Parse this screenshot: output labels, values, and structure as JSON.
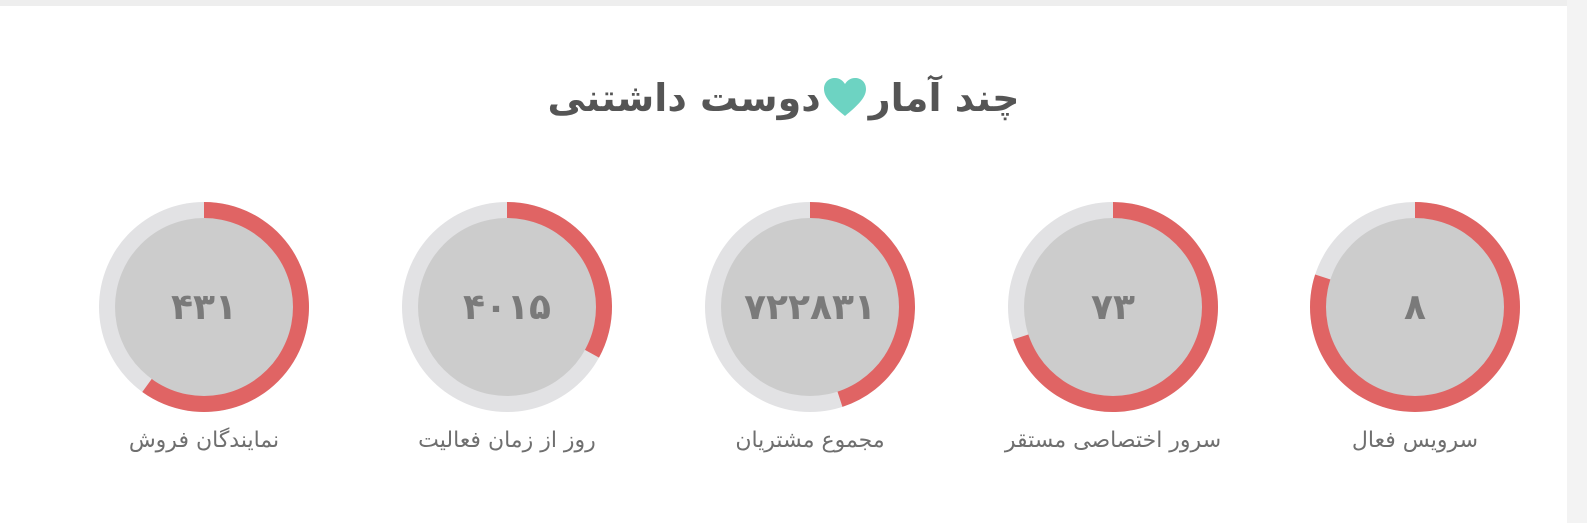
{
  "section": {
    "title_part1": "چند آمار",
    "title_part2": "دوست داشتنی",
    "heart_color": "#6dd3c2"
  },
  "colors": {
    "ring_fill": "#e06464",
    "ring_track": "#e2e2e4",
    "inner_circle": "#cccccc"
  },
  "stats": [
    {
      "value": "۸",
      "label": "سرویس فعال",
      "progress": 0.8
    },
    {
      "value": "۷۳",
      "label": "سرور اختصاصی مستقر",
      "progress": 0.7
    },
    {
      "value": "۷۲۲۸۳۱",
      "label": "مجموع مشتریان",
      "progress": 0.45
    },
    {
      "value": "۴۰۱۵",
      "label": "روز از زمان فعالیت",
      "progress": 0.33
    },
    {
      "value": "۴۳۱",
      "label": "نمایندگان فروش",
      "progress": 0.6
    }
  ]
}
